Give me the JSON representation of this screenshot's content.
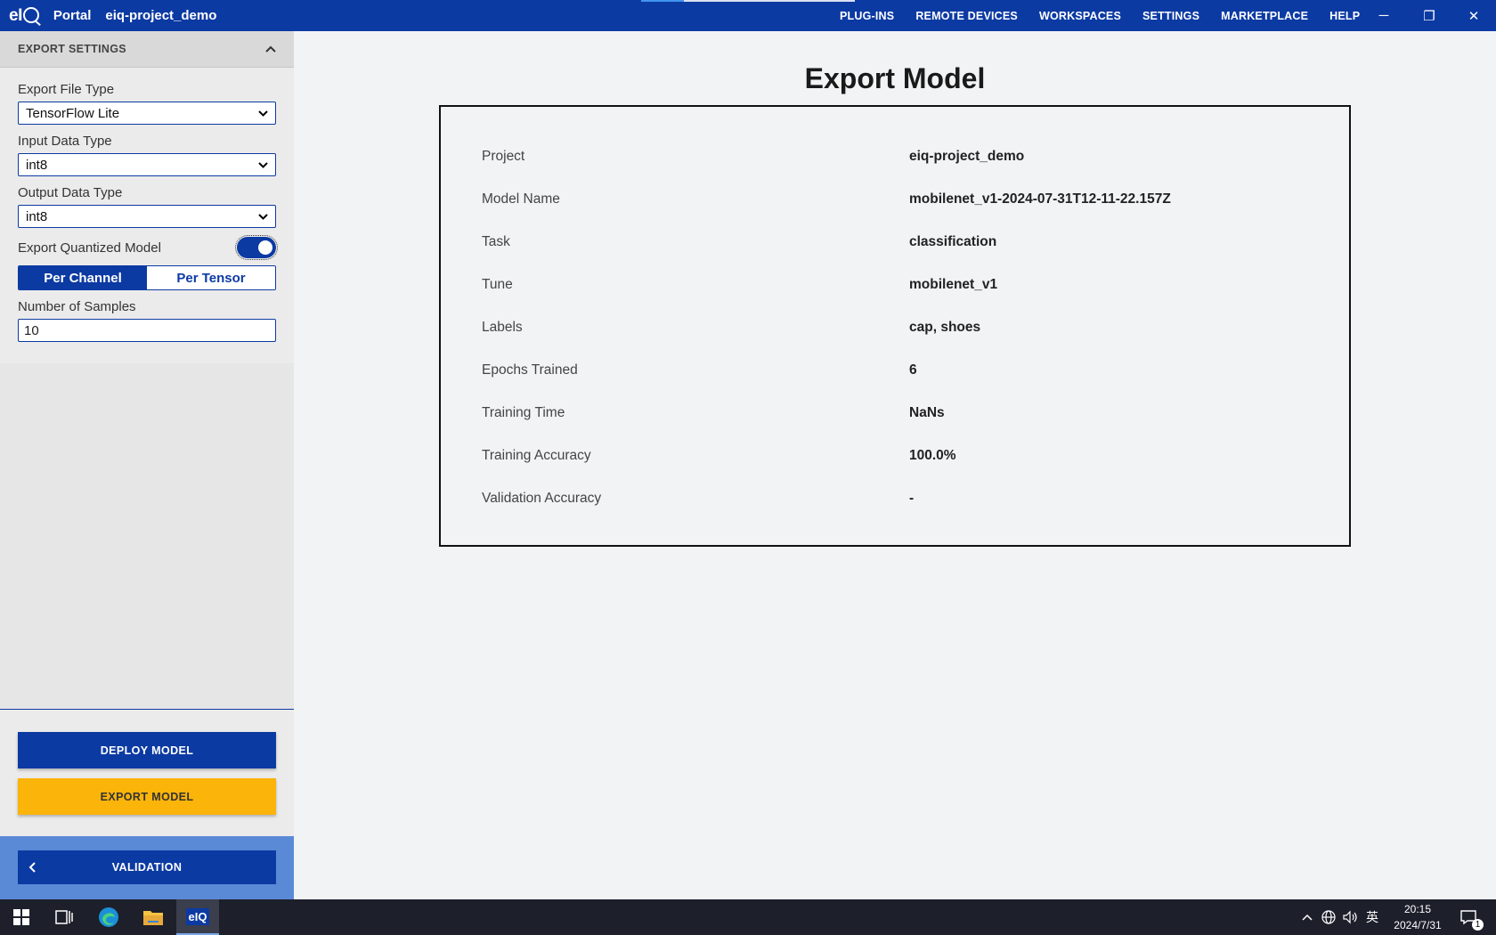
{
  "titlebar": {
    "logo": "eIQ",
    "app_name": "Portal",
    "project_name": "eiq-project_demo",
    "nav": [
      "PLUG-INS",
      "REMOTE DEVICES",
      "WORKSPACES",
      "SETTINGS",
      "MARKETPLACE",
      "HELP"
    ],
    "minimize": "─",
    "restore": "❐",
    "close": "✕"
  },
  "sidebar": {
    "section_title": "EXPORT SETTINGS",
    "export_file_type": {
      "label": "Export File Type",
      "value": "TensorFlow Lite"
    },
    "input_data_type": {
      "label": "Input Data Type",
      "value": "int8"
    },
    "output_data_type": {
      "label": "Output Data Type",
      "value": "int8"
    },
    "quantized": {
      "label": "Export Quantized Model",
      "enabled": true
    },
    "quant_mode": {
      "options": [
        "Per Channel",
        "Per Tensor"
      ],
      "selected": "Per Channel"
    },
    "num_samples": {
      "label": "Number of Samples",
      "value": "10"
    },
    "deploy_label": "DEPLOY MODEL",
    "export_label": "EXPORT MODEL",
    "back_label": "VALIDATION"
  },
  "main": {
    "title": "Export Model",
    "details": [
      {
        "key": "Project",
        "value": "eiq-project_demo"
      },
      {
        "key": "Model Name",
        "value": "mobilenet_v1-2024-07-31T12-11-22.157Z"
      },
      {
        "key": "Task",
        "value": "classification"
      },
      {
        "key": "Tune",
        "value": "mobilenet_v1"
      },
      {
        "key": "Labels",
        "value": "cap, shoes"
      },
      {
        "key": "Epochs Trained",
        "value": "6"
      },
      {
        "key": "Training Time",
        "value": "NaNs"
      },
      {
        "key": "Training Accuracy",
        "value": "100.0%"
      },
      {
        "key": "Validation Accuracy",
        "value": "-"
      }
    ]
  },
  "taskbar": {
    "eiq_label": "eIQ",
    "ime": "英",
    "time": "20:15",
    "date": "2024/7/31",
    "notifications": "1"
  },
  "colors": {
    "brand_blue": "#0c3aa3",
    "export_yellow": "#fbb40a",
    "taskbar": "#1d1f2b"
  }
}
